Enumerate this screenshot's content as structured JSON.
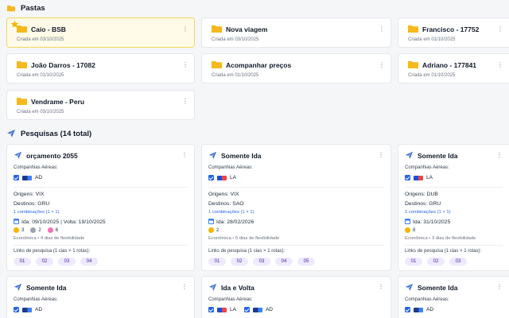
{
  "folders_section": {
    "title": "Pastas",
    "icon": "folder-icon"
  },
  "folders": [
    {
      "name": "Caio - BSB",
      "date": "Criada em 03/10/2025",
      "starred": true
    },
    {
      "name": "Nova viagem",
      "date": "Criada em 03/10/2025"
    },
    {
      "name": "Francisco - 17752",
      "date": "Criada em 01/10/2025"
    },
    {
      "name": "João Darros - 17082",
      "date": "Criada em 01/10/2025"
    },
    {
      "name": "Acompanhar preços",
      "date": "Criada em 01/10/2025"
    },
    {
      "name": "Adriano - 177841",
      "date": "Criada em 01/10/2025"
    },
    {
      "name": "Vendrame - Peru",
      "date": "Criada em 03/10/2025"
    }
  ],
  "searches_section": {
    "title": "Pesquisas (14 total)",
    "icon": "airplane-icon"
  },
  "common": {
    "airlines_label": "Companhias Aéreas:",
    "links_label": "Links de pesquisa (1 cias × 1 rotas):",
    "kebab": "⋮"
  },
  "searches": [
    {
      "title": "orçamento 2055",
      "airlines": [
        "AD"
      ],
      "origins": "Origens: VIX",
      "destinations": "Destinos: GRU",
      "combos": "1 combinações (1 × 1)",
      "dates": "Ida: 09/10/2025 | Volta: 19/10/2025",
      "badge1": "3",
      "badge2": "2",
      "badge3": "6",
      "flex": "Econômica • 4 dias de flexibilidade",
      "links": [
        "01",
        "02",
        "03",
        "04"
      ]
    },
    {
      "title": "Somente Ida",
      "airlines": [
        "LA"
      ],
      "origins": "Origens: VIX",
      "destinations": "Destinos: SAO",
      "combos": "1 combinações (1 × 1)",
      "dates": "Ida: 28/02/2026",
      "badge1": "2",
      "flex": "Econômica • 5 dias de flexibilidade",
      "links": [
        "01",
        "02",
        "03",
        "04",
        "05"
      ]
    },
    {
      "title": "Somente Ida",
      "airlines": [
        "LA"
      ],
      "origins": "Origens: DUB",
      "destinations": "Destinos: GRU",
      "combos": "1 combinações (1 × 1)",
      "dates": "Ida: 31/10/2025",
      "badge1": "8",
      "flex": "Econômica • 3 dias de flexibilidade",
      "links": [
        "01",
        "02",
        "03"
      ]
    },
    {
      "title": "Somente Ida",
      "airlines": [
        "AD"
      ]
    },
    {
      "title": "Ida e Volta",
      "airlines": [
        "LA",
        "AD"
      ]
    },
    {
      "title": "Somente Ida",
      "airlines": [
        "AD"
      ]
    }
  ]
}
